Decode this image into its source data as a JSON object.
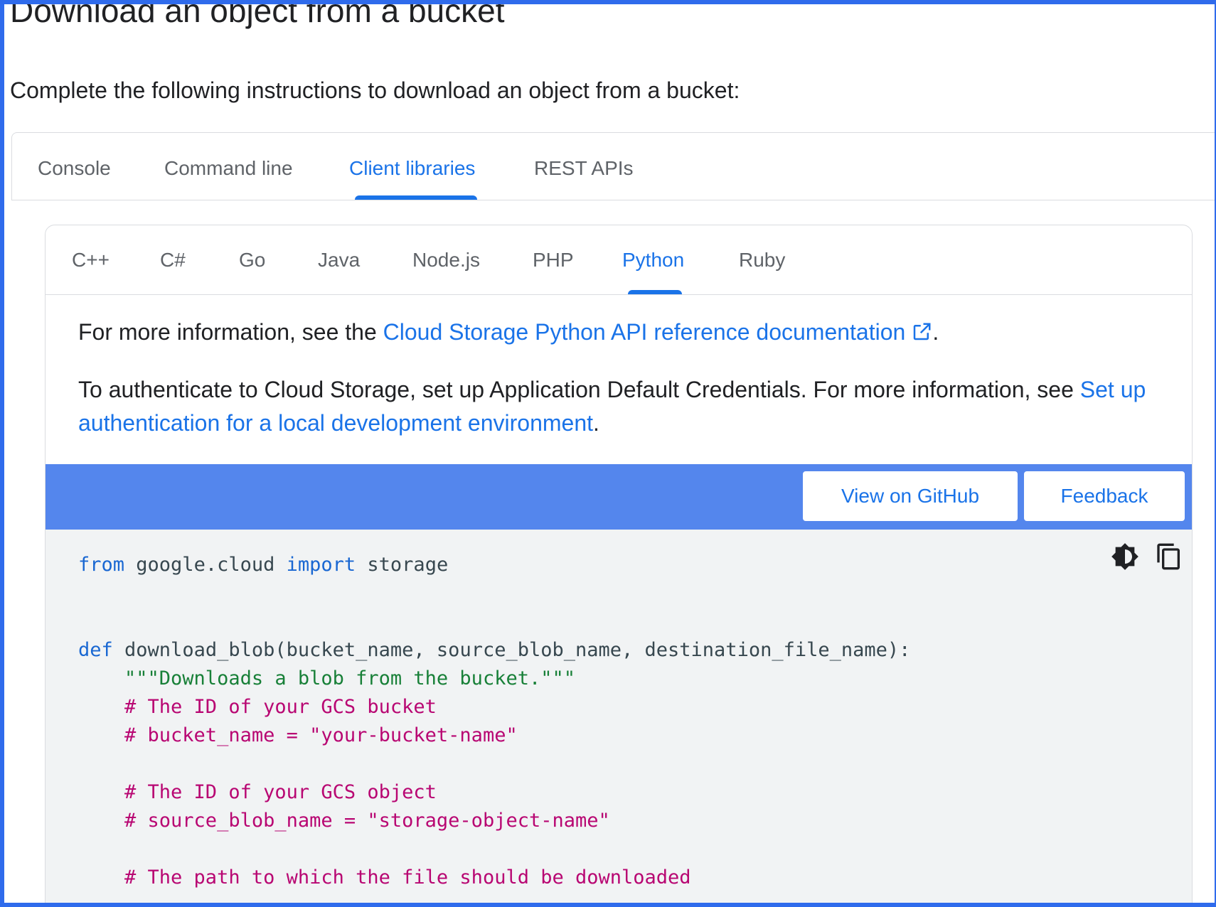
{
  "page": {
    "heading": "Download an object from a bucket",
    "intro": "Complete the following instructions to download an object from a bucket:"
  },
  "outer_tabs": [
    {
      "label": "Console",
      "active": false
    },
    {
      "label": "Command line",
      "active": false
    },
    {
      "label": "Client libraries",
      "active": true
    },
    {
      "label": "REST APIs",
      "active": false
    }
  ],
  "inner_tabs": [
    {
      "label": "C++",
      "active": false
    },
    {
      "label": "C#",
      "active": false
    },
    {
      "label": "Go",
      "active": false
    },
    {
      "label": "Java",
      "active": false
    },
    {
      "label": "Node.js",
      "active": false
    },
    {
      "label": "PHP",
      "active": false
    },
    {
      "label": "Python",
      "active": true
    },
    {
      "label": "Ruby",
      "active": false
    }
  ],
  "info": {
    "p1_prefix": "For more information, see the ",
    "p1_link": "Cloud Storage Python API reference documentation",
    "p1_suffix": ".",
    "p2_prefix": "To authenticate to Cloud Storage, set up Application Default Credentials. For more information, see ",
    "p2_link": "Set up authentication for a local development environment",
    "p2_suffix": "."
  },
  "code_toolbar": {
    "github_label": "View on GitHub",
    "feedback_label": "Feedback",
    "theme_icon": "dark-mode-toggle-icon",
    "copy_icon": "copy-icon"
  },
  "colors": {
    "accent": "#1a73e8",
    "toolbar": "#5486ed",
    "frame": "#2f6bec",
    "code_bg": "#f1f3f4",
    "keyword": "#1967d2",
    "string": "#188038",
    "comment": "#b80672"
  },
  "code": {
    "l1_kw1": "from",
    "l1_mod": " google.cloud ",
    "l1_kw2": "import",
    "l1_name": " storage",
    "l4_kw": "def",
    "l4_rest": " download_blob(bucket_name, source_blob_name, destination_file_name):",
    "l5_doc": "    \"\"\"Downloads a blob from the bucket.\"\"\"",
    "l6_cmt": "    # The ID of your GCS bucket",
    "l7_cmt": "    # bucket_name = \"your-bucket-name\"",
    "l9_cmt": "    # The ID of your GCS object",
    "l10_cmt": "    # source_blob_name = \"storage-object-name\"",
    "l12_cmt": "    # The path to which the file should be downloaded"
  }
}
